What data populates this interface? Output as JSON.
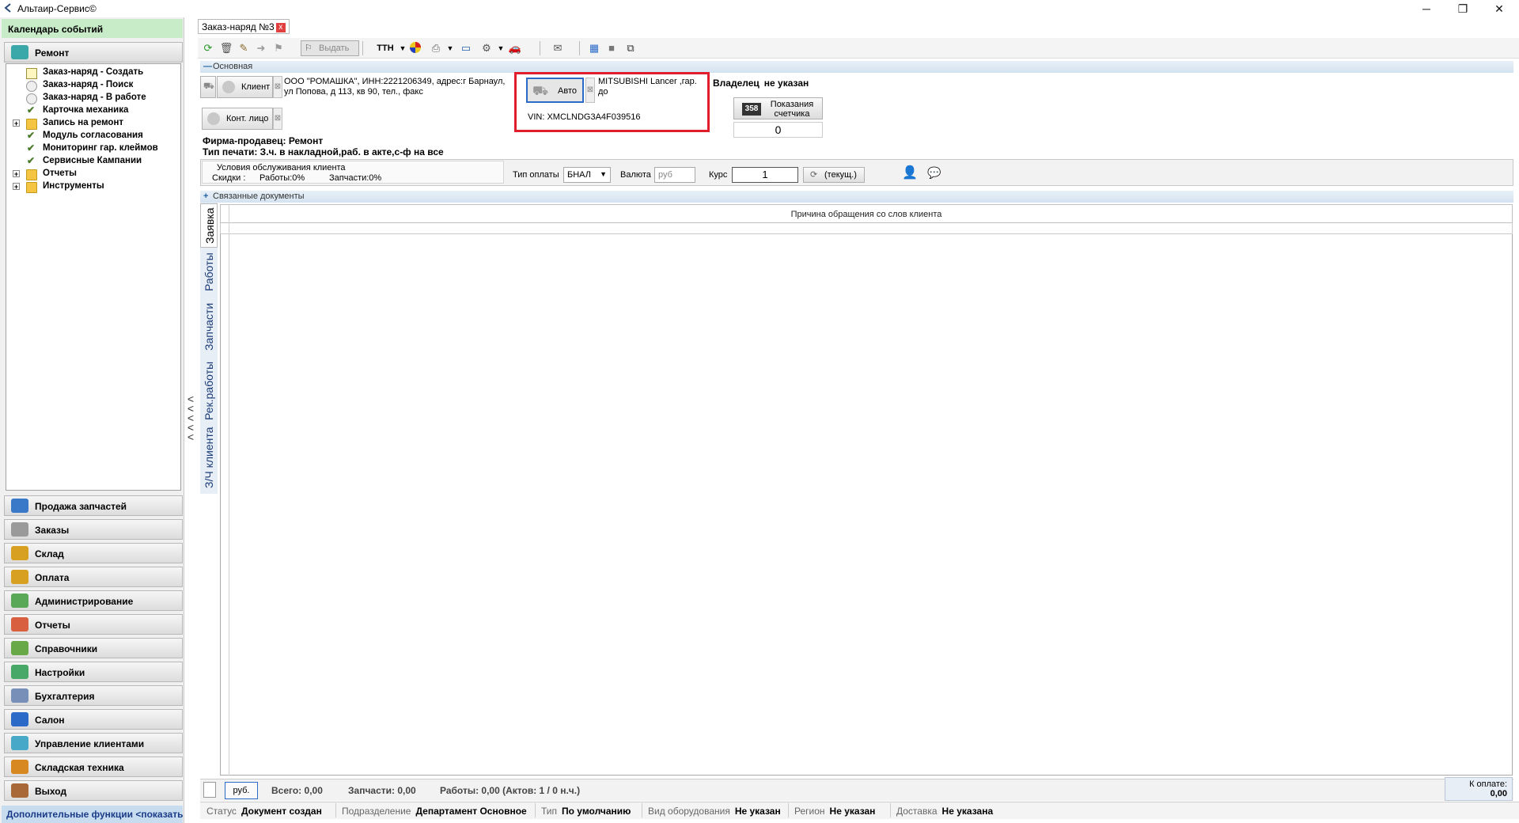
{
  "window": {
    "title": "Альтаир-Сервис©",
    "minimize": "─",
    "restore": "❐",
    "close": "✕"
  },
  "left": {
    "calendar_header": "Календарь событий",
    "repair_section": "Ремонт",
    "tree": [
      {
        "label": "Заказ-наряд - Создать",
        "icon": "doc"
      },
      {
        "label": "Заказ-наряд - Поиск",
        "icon": "circle"
      },
      {
        "label": "Заказ-наряд - В работе",
        "icon": "circle"
      },
      {
        "label": "Карточка механика",
        "icon": "check"
      },
      {
        "label": "Запись на ремонт",
        "icon": "folder"
      },
      {
        "label": "Модуль согласования",
        "icon": "check"
      },
      {
        "label": "Мониторинг гар. клеймов",
        "icon": "check"
      },
      {
        "label": "Сервисные Кампании",
        "icon": "check"
      },
      {
        "label": "Отчеты",
        "icon": "folder"
      },
      {
        "label": "Инструменты",
        "icon": "folder"
      }
    ],
    "expander": "+",
    "nav": [
      {
        "label": "Продажа запчастей",
        "color": "#3a78c8"
      },
      {
        "label": "Заказы",
        "color": "#9a9a9a"
      },
      {
        "label": "Склад",
        "color": "#d8a020"
      },
      {
        "label": "Оплата",
        "color": "#d8a020"
      },
      {
        "label": "Администрирование",
        "color": "#58a858"
      },
      {
        "label": "Отчеты",
        "color": "#d86040"
      },
      {
        "label": "Справочники",
        "color": "#68a848"
      },
      {
        "label": "Настройки",
        "color": "#48a868"
      },
      {
        "label": "Бухгалтерия",
        "color": "#7890b8"
      },
      {
        "label": "Салон",
        "color": "#2c6ac8"
      },
      {
        "label": "Управление клиентами",
        "color": "#48a8c8"
      },
      {
        "label": "Складская техника",
        "color": "#d88820"
      },
      {
        "label": "Выход",
        "color": "#a86838"
      }
    ],
    "footer": "Дополнительные функции <показать",
    "collapse_arrows": "<\n<\n<\n<\n<"
  },
  "doc_tab": {
    "label": "Заказ-наряд №3",
    "close": "x"
  },
  "toolbar": {
    "issue_label": "Выдать",
    "ttn_label": "ТТН"
  },
  "main_section": "Основная",
  "client": {
    "button": "Клиент",
    "x": "⊠",
    "text": "ООО \"РОМАШКА\", ИНН:2221206349, адрес:г Барнаул, ул Попова, д 113, кв 90, тел., факс",
    "contact_button": "Конт. лицо"
  },
  "auto": {
    "button": "Авто",
    "car": "MITSUBISHI Lancer ,гар. до",
    "vin": "VIN: XMCLNDG3A4F039516"
  },
  "owner": {
    "key": "Владелец",
    "value": "не указан"
  },
  "counter": {
    "icon": "358",
    "label": "Показания счетчика",
    "value": "0"
  },
  "firm": "Фирма-продавец: Ремонт",
  "print_type": "Тип печати: З.ч. в накладной,раб. в акте,с-ф на все",
  "conditions": {
    "title": "Условия обслуживания клиента",
    "discounts": "Скидки :",
    "works": "Работы:0%",
    "parts": "Запчасти:0%"
  },
  "payment": {
    "type_label": "Тип оплаты",
    "type_value": "БНАЛ",
    "currency_label": "Валюта",
    "currency_value": "руб",
    "rate_label": "Курс",
    "rate_value": "1",
    "current_btn": "(текущ.)"
  },
  "linked_section": "Связанные документы",
  "side_tabs": [
    "Заявка",
    "Работы",
    "Запчасти",
    "Рек.работы",
    "З/Ч клиента"
  ],
  "grid": {
    "column": "Причина обращения со слов клиента"
  },
  "totals": {
    "currency_btn": "руб.",
    "total": "Всего: 0,00",
    "parts": "Запчасти: 0,00",
    "works": "Работы: 0,00 (Актов: 1 / 0 н.ч.)",
    "to_pay_label": "К оплате:",
    "to_pay_value": "0,00"
  },
  "status": [
    {
      "key": "Статус",
      "value": "Документ создан"
    },
    {
      "key": "Подразделение",
      "value": "Департамент Основное"
    },
    {
      "key": "Тип",
      "value": "По умолчанию"
    },
    {
      "key": "Вид оборудования",
      "value": "Не указан"
    },
    {
      "key": "Регион",
      "value": "Не указан"
    },
    {
      "key": "Доставка",
      "value": "Не указана"
    }
  ]
}
